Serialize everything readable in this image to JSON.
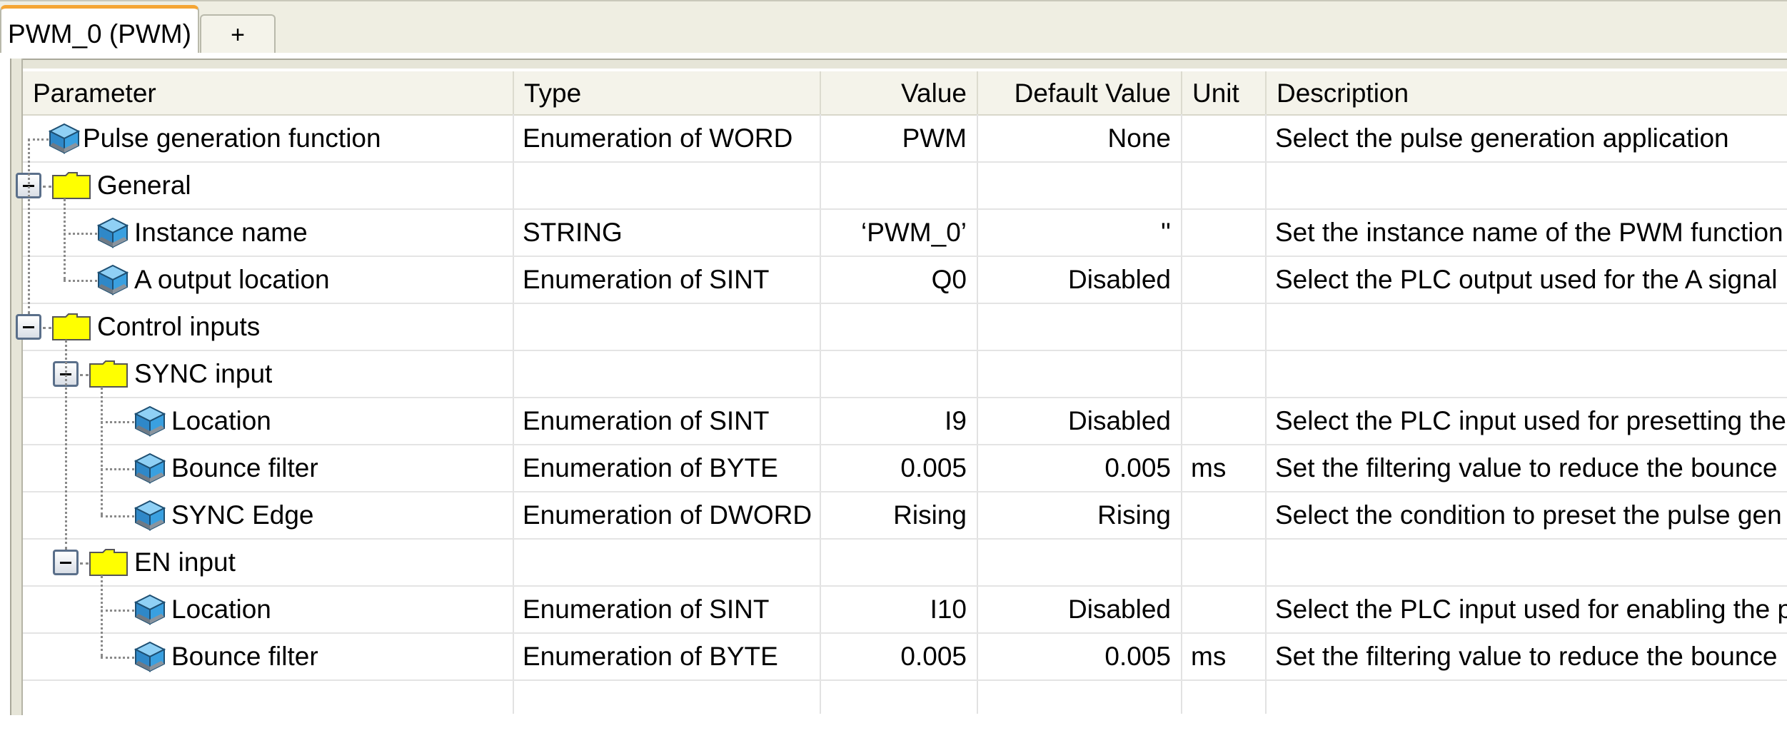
{
  "tabs": {
    "active_label": "PWM_0 (PWM)",
    "add_label": "+"
  },
  "columns": {
    "parameter": "Parameter",
    "type": "Type",
    "value": "Value",
    "default_value": "Default Value",
    "unit": "Unit",
    "description": "Description"
  },
  "rows": [
    {
      "parameter": "Pulse generation function",
      "type": "Enumeration of WORD",
      "value": "PWM",
      "default": "None",
      "unit": "",
      "description": "Select the pulse generation application",
      "kind": "param",
      "level": 0
    },
    {
      "parameter": "General",
      "type": "",
      "value": "",
      "default": "",
      "unit": "",
      "description": "",
      "kind": "folder",
      "level": 0
    },
    {
      "parameter": "Instance name",
      "type": "STRING",
      "value": "‘PWM_0’",
      "default": "''",
      "unit": "",
      "description": "Set the instance name of the PWM function",
      "kind": "param",
      "level": 1
    },
    {
      "parameter": "A output location",
      "type": "Enumeration of SINT",
      "value": "Q0",
      "default": "Disabled",
      "unit": "",
      "description": "Select the PLC output used for the A signal",
      "kind": "param",
      "level": 1
    },
    {
      "parameter": "Control inputs",
      "type": "",
      "value": "",
      "default": "",
      "unit": "",
      "description": "",
      "kind": "folder",
      "level": 0
    },
    {
      "parameter": "SYNC input",
      "type": "",
      "value": "",
      "default": "",
      "unit": "",
      "description": "",
      "kind": "folder",
      "level": 1
    },
    {
      "parameter": "Location",
      "type": "Enumeration of SINT",
      "value": "I9",
      "default": "Disabled",
      "unit": "",
      "description": "Select the PLC input used for presetting the",
      "kind": "param",
      "level": 2
    },
    {
      "parameter": "Bounce filter",
      "type": "Enumeration of BYTE",
      "value": "0.005",
      "default": "0.005",
      "unit": "ms",
      "description": "Set the filtering value to reduce the bounce",
      "kind": "param",
      "level": 2
    },
    {
      "parameter": "SYNC Edge",
      "type": "Enumeration of DWORD",
      "value": "Rising",
      "default": "Rising",
      "unit": "",
      "description": "Select the condition to preset the pulse gen",
      "kind": "param",
      "level": 2
    },
    {
      "parameter": "EN input",
      "type": "",
      "value": "",
      "default": "",
      "unit": "",
      "description": "",
      "kind": "folder",
      "level": 1
    },
    {
      "parameter": "Location",
      "type": "Enumeration of SINT",
      "value": "I10",
      "default": "Disabled",
      "unit": "",
      "description": "Select the PLC input used for enabling the p",
      "kind": "param",
      "level": 2
    },
    {
      "parameter": "Bounce filter",
      "type": "Enumeration of BYTE",
      "value": "0.005",
      "default": "0.005",
      "unit": "ms",
      "description": "Set the filtering value to reduce the bounce",
      "kind": "param",
      "level": 2
    }
  ],
  "icons": {
    "parameter": "parameter-cube-icon",
    "folder": "folder-icon",
    "expander": "collapse-icon"
  },
  "colors": {
    "tab_accent": "#f5a533",
    "folder": "#ffff00",
    "cube_face": "#3aa0e0"
  }
}
